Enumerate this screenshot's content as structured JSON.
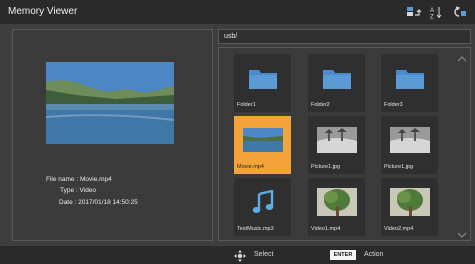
{
  "app": {
    "title": "Memory Viewer"
  },
  "toolbar": {
    "icons": [
      "storage-switch-icon",
      "sort-icon",
      "return-icon"
    ]
  },
  "path": {
    "value": "usb/"
  },
  "preview": {
    "file_name_label": "File name :",
    "file_name_value": "Movie.mp4",
    "type_label": "Type :",
    "type_value": "Video",
    "date_label": "Date :",
    "date_value": "2017/01/18  14:50:25"
  },
  "grid": {
    "items": [
      {
        "label": "Folder1",
        "kind": "folder"
      },
      {
        "label": "Folder2",
        "kind": "folder"
      },
      {
        "label": "Folder3",
        "kind": "folder"
      },
      {
        "label": "Movie.mp4",
        "kind": "video",
        "selected": true
      },
      {
        "label": "Picture1.jpg",
        "kind": "photo-bw"
      },
      {
        "label": "Picture1.jpg",
        "kind": "photo-bw"
      },
      {
        "label": "TestMusic.mp3",
        "kind": "music"
      },
      {
        "label": "Video1.mp4",
        "kind": "video-tree"
      },
      {
        "label": "Video2.mp4",
        "kind": "video-tree"
      }
    ]
  },
  "footer": {
    "select_label": "Select",
    "enter_key": "ENTER",
    "action_label": "Action"
  },
  "colors": {
    "selection": "#f2a43a",
    "folder": "#5b9bd5",
    "music": "#5aaee5"
  }
}
